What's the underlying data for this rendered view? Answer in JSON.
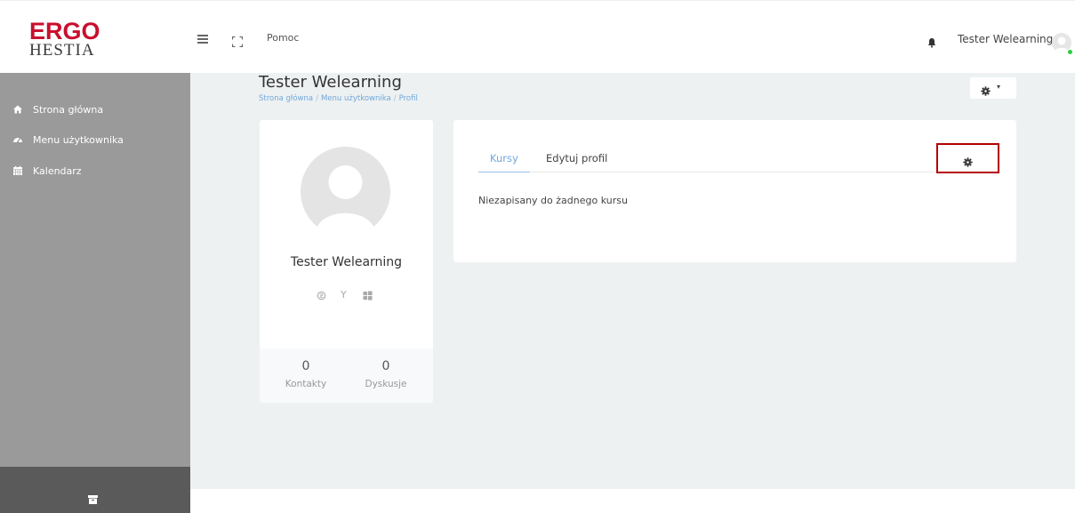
{
  "brand": {
    "line1": "ERGO",
    "line2": "HESTIA",
    "red": "#c8102e"
  },
  "topbar": {
    "menu_icon": "hamburger-icon",
    "fullscreen_icon": "fullscreen-icon",
    "help_label": "Pomoc",
    "bell_icon": "bell-icon",
    "user_name": "Tester Welearning"
  },
  "sidebar": {
    "items": [
      {
        "label": "Strona główna",
        "icon": "home-icon"
      },
      {
        "label": "Menu użytkownika",
        "icon": "dashboard-icon"
      },
      {
        "label": "Kalendarz",
        "icon": "calendar-icon"
      }
    ],
    "footer_icon": "archive-icon"
  },
  "page": {
    "title": "Tester Welearning",
    "breadcrumb": [
      "Strona główna",
      "Menu użytkownika",
      "Profil"
    ],
    "breadcrumb_sep": "/"
  },
  "profile": {
    "name": "Tester Welearning",
    "social": [
      "skype-icon",
      "yahoo-icon",
      "windows-icon"
    ],
    "stats": [
      {
        "value": "0",
        "label": "Kontakty"
      },
      {
        "value": "0",
        "label": "Dyskusje"
      }
    ]
  },
  "courses": {
    "tabs": [
      {
        "label": "Kursy",
        "active": true
      },
      {
        "label": "Edytuj profil",
        "active": false
      }
    ],
    "empty_text": "Niezapisany do żadnego kursu"
  },
  "colors": {
    "sidebar": "#9a9a9a",
    "sidebar_footer": "#5a5a5a",
    "content_bg": "#eef1f2",
    "link": "#6fa8dc",
    "highlight_border": "#b20000",
    "online": "#2ecc40"
  }
}
